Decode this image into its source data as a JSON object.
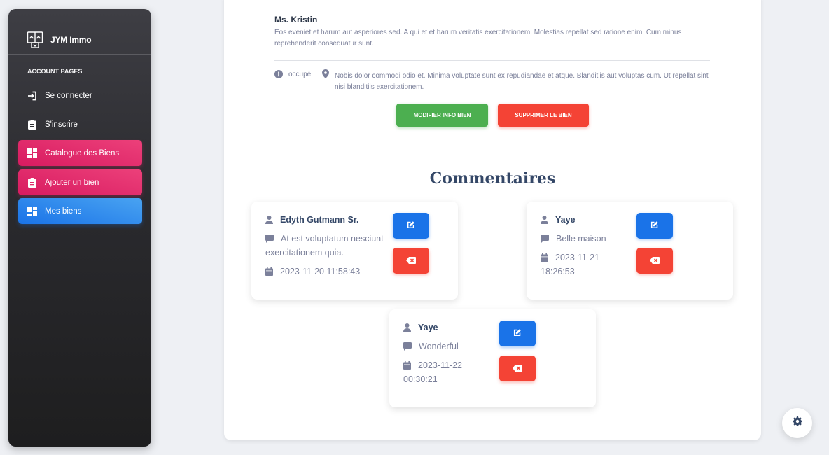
{
  "sidebar": {
    "brand": "JYM Immo",
    "heading": "ACCOUNT PAGES",
    "items": [
      {
        "label": "Se connecter"
      },
      {
        "label": "S'inscrire"
      },
      {
        "label": "Catalogue des Biens"
      },
      {
        "label": "Ajouter un bien"
      },
      {
        "label": "Mes biens"
      }
    ]
  },
  "property": {
    "owner_name": "Ms. Kristin",
    "owner_description": "Eos eveniet et harum aut asperiores sed. A qui et et harum veritatis exercitationem. Molestias repellat sed ratione enim. Cum minus reprehenderit consequatur sunt.",
    "status": "occupé",
    "address": "Nobis dolor commodi odio et. Minima voluptate sunt ex repudiandae et atque. Blanditiis aut voluptas cum. Ut repellat sint nisi blanditiis exercitationem.",
    "edit_label": "MODIFIER INFO BIEN",
    "delete_label": "SUPPRIMER LE BIEN"
  },
  "comments_section": {
    "title": "Commentaires",
    "comments": [
      {
        "author": "Edyth Gutmann Sr.",
        "text_line1": "At est voluptatum nesciunt",
        "text_line2": "exercitationem quia.",
        "date": "2023-11-20 11:58:43"
      },
      {
        "author": "Yaye",
        "text": "Belle maison",
        "date_line1": "2023-11-21",
        "date_line2": "18:26:53"
      },
      {
        "author": "Yaye",
        "text": "Wonderful",
        "date_line1": "2023-11-22",
        "date_line2": "00:30:21"
      }
    ]
  },
  "colors": {
    "pink": "#e91e63",
    "blue": "#1a73e8",
    "green": "#4caf50",
    "red": "#f44335"
  },
  "icons": [
    "house-logo-icon",
    "login-icon",
    "clipboard-icon",
    "dashboard-icon",
    "info-circle-icon",
    "map-pin-icon",
    "user-icon",
    "comment-icon",
    "calendar-icon",
    "edit-icon",
    "backspace-icon",
    "gear-icon"
  ]
}
